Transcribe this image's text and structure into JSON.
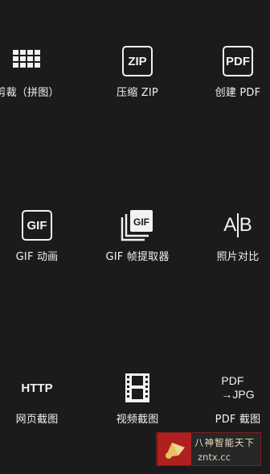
{
  "tools": [
    {
      "label": "剪裁（拼图）",
      "icon": "grid-icon"
    },
    {
      "label": "压缩 ZIP",
      "icon": "zip-icon",
      "icon_text": "ZIP"
    },
    {
      "label": "创建 PDF",
      "icon": "pdf-icon",
      "icon_text": "PDF"
    },
    {
      "label": "GIF 动画",
      "icon": "gif-icon",
      "icon_text": "GIF"
    },
    {
      "label": "GIF 帧提取器",
      "icon": "gif-frames-icon",
      "icon_text": "GIF"
    },
    {
      "label": "照片对比",
      "icon": "compare-icon",
      "icon_left": "A",
      "icon_right": "B"
    },
    {
      "label": "网页截图",
      "icon": "http-icon",
      "icon_text": "HTTP"
    },
    {
      "label": "视频截图",
      "icon": "film-icon"
    },
    {
      "label": "PDF 截图",
      "icon": "pdf-to-jpg-icon",
      "icon_line1": "PDF",
      "icon_line2": "→JPG"
    }
  ],
  "watermark": {
    "line1": "八神智能天下",
    "line2": "zntx.cc"
  },
  "colors": {
    "background": "#1b1b1b",
    "foreground": "#f2f2f2",
    "watermark_accent": "#b02020"
  }
}
